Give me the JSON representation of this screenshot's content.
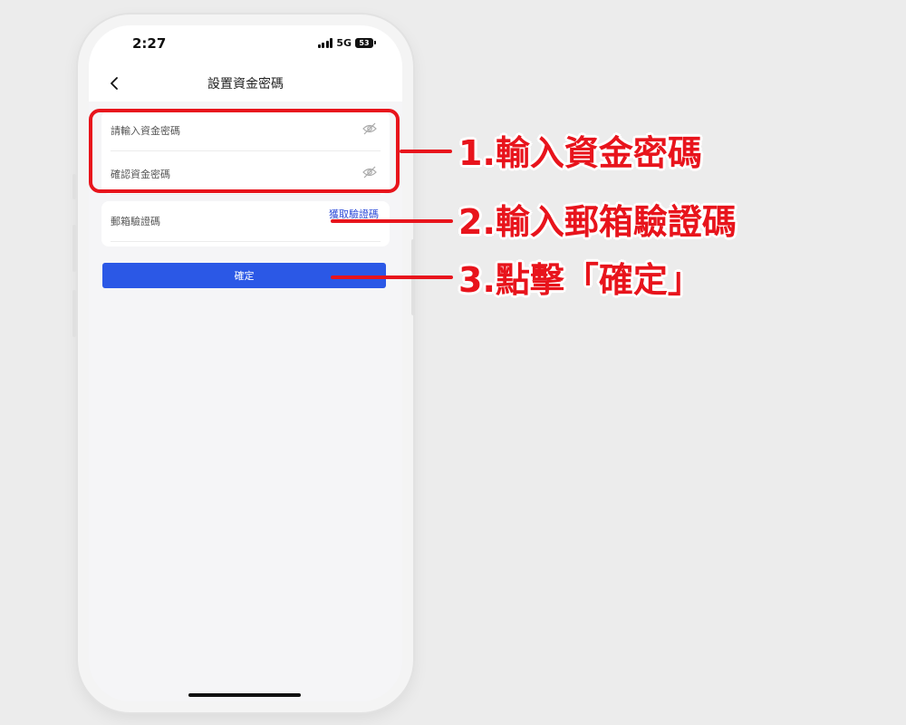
{
  "status_bar": {
    "time": "2:27",
    "network": "5G",
    "battery": "53"
  },
  "nav": {
    "title": "設置資金密碼"
  },
  "form": {
    "fund_password_placeholder": "請輸入資金密碼",
    "confirm_password_placeholder": "確認資金密碼",
    "email_code_placeholder": "郵箱驗證碼",
    "get_code_label": "獲取驗證碼",
    "confirm_button": "確定"
  },
  "annotations": {
    "step1": "1.輸入資金密碼",
    "step2": "2.輸入郵箱驗證碼",
    "step3": "3.點擊「確定」"
  },
  "colors": {
    "accent": "#2b58e6",
    "annotation": "#e8141c",
    "link": "#2b4ad8"
  }
}
